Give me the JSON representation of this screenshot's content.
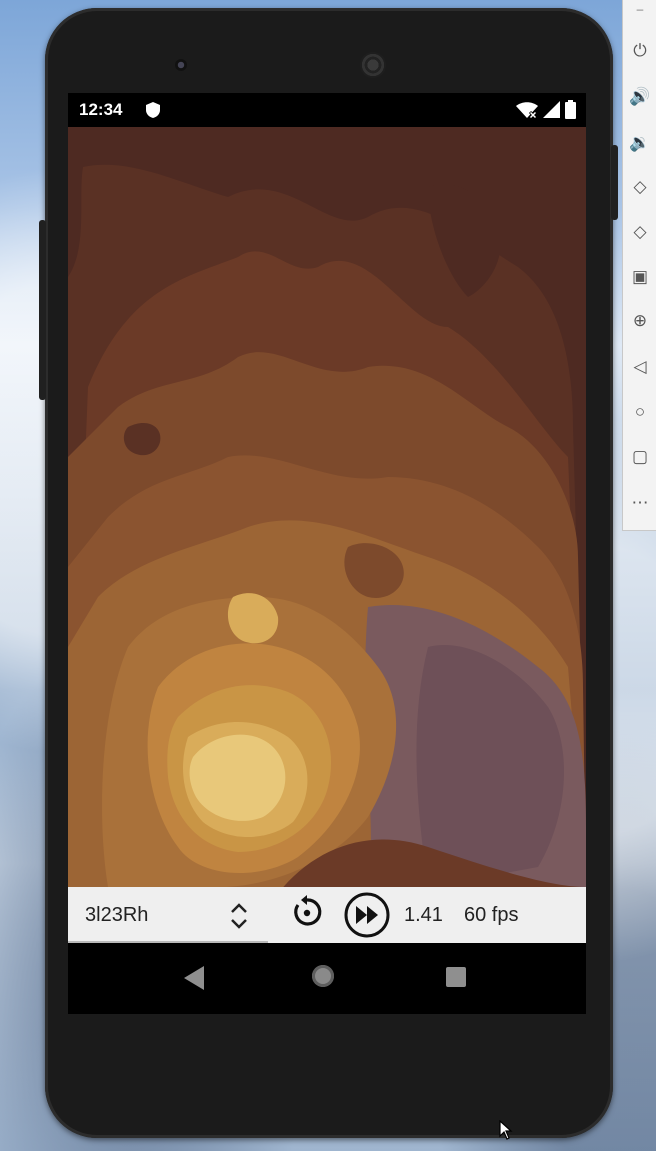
{
  "status_bar": {
    "time": "12:34",
    "icons": [
      "shield-icon",
      "wifi-off-icon",
      "cell-signal-icon",
      "battery-icon"
    ]
  },
  "emulator_toolbar": {
    "items": [
      "power-icon",
      "volume-up-icon",
      "volume-down-icon",
      "rotate-left-icon",
      "rotate-right-icon",
      "camera-icon",
      "zoom-icon",
      "back-icon",
      "home-icon",
      "overview-icon",
      "more-icon"
    ],
    "glyphs": [
      "⏻",
      "🔊",
      "🔉",
      "◇",
      "◇",
      "▣",
      "⊕",
      "◁",
      "○",
      "▢",
      "⋯"
    ],
    "minimize": "–"
  },
  "shader": {
    "name": "3l23Rh",
    "speed": "1.41",
    "fps": "60 fps",
    "palette": [
      "#4e2a22",
      "#6b3a27",
      "#8b5430",
      "#a9713a",
      "#c99545",
      "#e8c87a",
      "#7a5a5e"
    ]
  },
  "nav_bar": {
    "buttons": [
      "back-button",
      "home-button",
      "recents-button"
    ]
  }
}
